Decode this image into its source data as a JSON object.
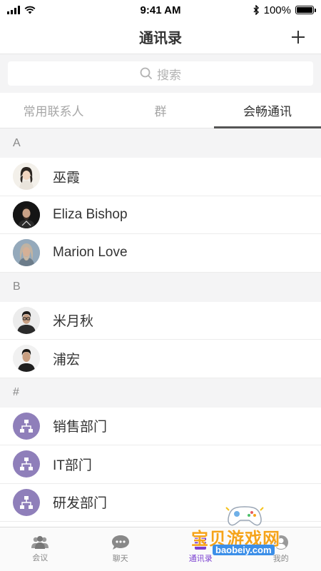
{
  "status": {
    "time": "9:41 AM",
    "battery": "100%"
  },
  "header": {
    "title": "通讯录"
  },
  "search": {
    "placeholder": "搜索"
  },
  "tabs": [
    {
      "label": "常用联系人",
      "active": false
    },
    {
      "label": "群",
      "active": false
    },
    {
      "label": "会畅通讯",
      "active": true
    }
  ],
  "sections": [
    {
      "letter": "A",
      "rows": [
        {
          "name": "巫霞"
        },
        {
          "name": "Eliza Bishop"
        },
        {
          "name": "Marion Love"
        }
      ]
    },
    {
      "letter": "B",
      "rows": [
        {
          "name": "米月秋"
        },
        {
          "name": "浦宏"
        }
      ]
    },
    {
      "letter": "#",
      "rows": [
        {
          "name": "销售部门"
        },
        {
          "name": "IT部门"
        },
        {
          "name": "研发部门"
        }
      ]
    }
  ],
  "tabbar": [
    {
      "label": "会议",
      "icon": "people-icon",
      "active": false
    },
    {
      "label": "聊天",
      "icon": "chat-bubble-icon",
      "active": false
    },
    {
      "label": "通讯录",
      "icon": "contacts-icon",
      "active": true
    },
    {
      "label": "我的",
      "icon": "profile-icon",
      "active": false
    }
  ],
  "watermark": {
    "text": "宝贝游戏网",
    "url": "baobeiy.com"
  },
  "colors": {
    "accent": "#7a3fd0",
    "group_avatar": "#8f7fba",
    "section_bg": "#f4f4f5"
  }
}
